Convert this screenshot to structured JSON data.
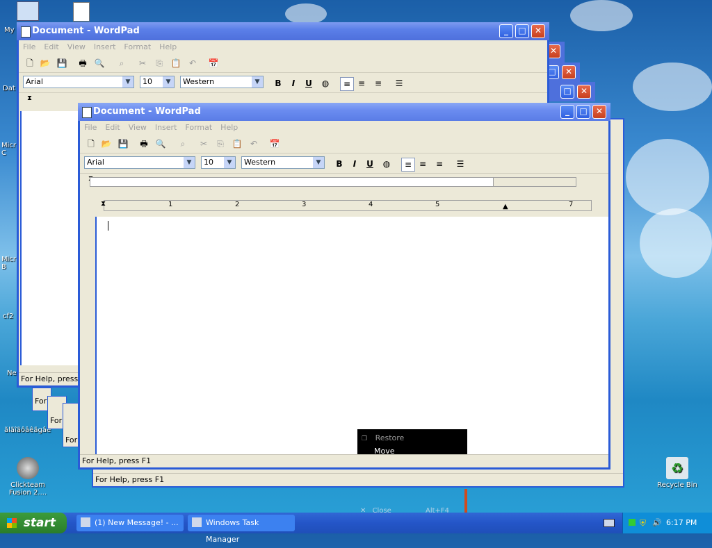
{
  "desktop": {
    "icons": [
      {
        "label": "My"
      },
      {
        "label": "Dat"
      },
      {
        "label": "Micr\nC"
      },
      {
        "label": "Micr\nB"
      },
      {
        "label": "cf2"
      },
      {
        "label": "Ne"
      },
      {
        "label": "ãlãîãôâêãgâê"
      },
      {
        "label": "Clickteam Fusion 2...."
      },
      {
        "label": "Recycle Bin"
      }
    ]
  },
  "wordpad": {
    "title": "Document - WordPad",
    "menu": [
      "File",
      "Edit",
      "View",
      "Insert",
      "Format",
      "Help"
    ],
    "font": "Arial",
    "size": "10",
    "script": "Western",
    "status": "For Help, press F1",
    "status_short": "For Help, press F",
    "status_stub": "For"
  },
  "ruler": {
    "numbers": [
      "1",
      "2",
      "3",
      "4",
      "5",
      "7"
    ]
  },
  "context_menu": {
    "items": [
      {
        "label": "Restore"
      },
      {
        "label": "Move"
      }
    ],
    "ghost_close": "Close",
    "ghost_shortcut": "Alt+F4"
  },
  "taskbar": {
    "start_label": "start",
    "tasks": [
      {
        "label": "(1) New Message! - ..."
      },
      {
        "label": "Windows Task Manager"
      }
    ],
    "clock": "6:17 PM"
  },
  "colors": {
    "xp_blue": "#2a5bd7",
    "close_red": "#c8401e",
    "window_bg": "#ece9d8"
  }
}
